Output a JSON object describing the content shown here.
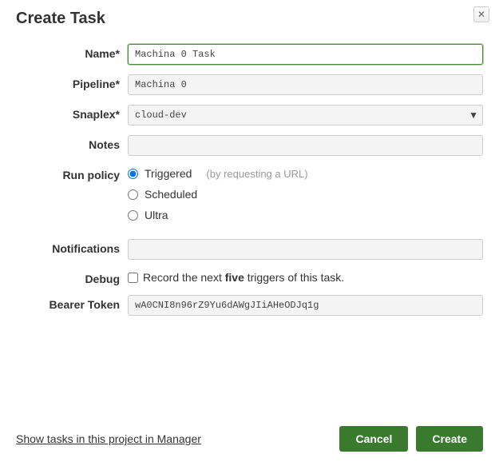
{
  "dialog": {
    "title": "Create Task"
  },
  "labels": {
    "name": "Name*",
    "pipeline": "Pipeline*",
    "snaplex": "Snaplex*",
    "notes": "Notes",
    "run_policy": "Run policy",
    "notifications": "Notifications",
    "debug": "Debug",
    "bearer_token": "Bearer Token"
  },
  "fields": {
    "name_value": "Machina 0 Task",
    "pipeline_value": "Machina 0",
    "snaplex_value": "cloud-dev",
    "notes_value": "",
    "notifications_value": "",
    "bearer_token_value": "wA0CNI8n96rZ9Yu6dAWgJIiAHeODJq1g"
  },
  "run_policy": {
    "options": {
      "triggered": "Triggered",
      "triggered_hint": "(by requesting a URL)",
      "scheduled": "Scheduled",
      "ultra": "Ultra"
    },
    "selected": "triggered"
  },
  "debug": {
    "text_pre": "Record the next ",
    "text_bold": "five",
    "text_post": " triggers of this task."
  },
  "footer": {
    "link": "Show tasks in this project in Manager",
    "cancel": "Cancel",
    "create": "Create"
  }
}
